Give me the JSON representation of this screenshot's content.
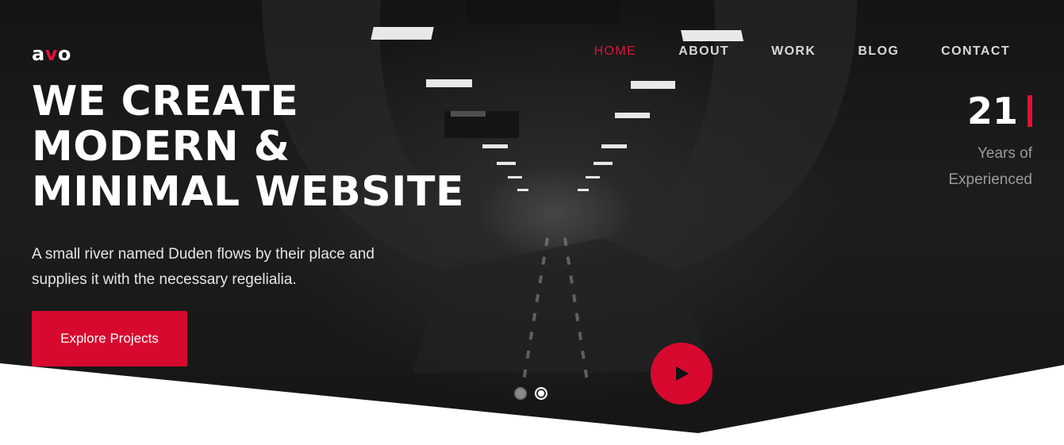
{
  "brand": {
    "logo_prefix": "a",
    "logo_accent": "v",
    "logo_suffix": "o",
    "accent_color": "#e0123a"
  },
  "nav": {
    "items": [
      {
        "label": "HOME",
        "active": true
      },
      {
        "label": "ABOUT",
        "active": false
      },
      {
        "label": "WORK",
        "active": false
      },
      {
        "label": "BLOG",
        "active": false
      },
      {
        "label": "CONTACT",
        "active": false
      }
    ]
  },
  "hero": {
    "headline_lines": [
      "WE CREATE",
      "MODERN &",
      "MINIMAL WEBSITE"
    ],
    "subtext": "A small river named Duden flows by their place and supplies it with the necessary regelialia.",
    "cta_label": "Explore Projects",
    "play_icon": "play-icon"
  },
  "experience": {
    "number": "21",
    "label_lines": [
      "Years of",
      "Experienced"
    ]
  },
  "slider": {
    "slide_count": 2,
    "active_index": 1
  }
}
